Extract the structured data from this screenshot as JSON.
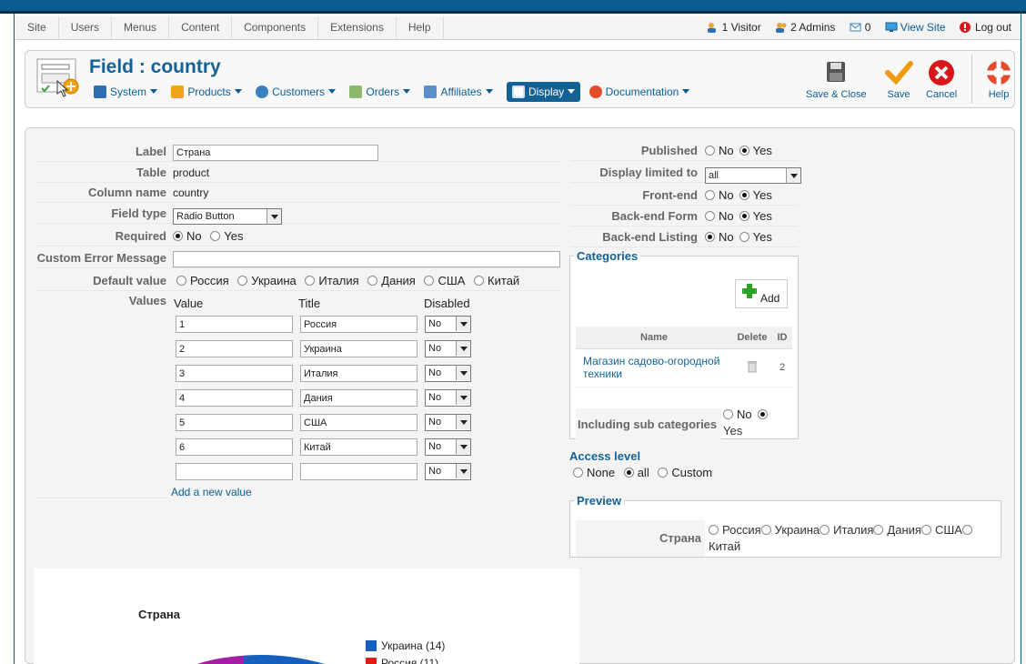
{
  "menubar": {
    "items": [
      "Site",
      "Users",
      "Menus",
      "Content",
      "Components",
      "Extensions",
      "Help"
    ],
    "visitors": "1 Visitor",
    "admins": "2 Admins",
    "messages": "0",
    "view_site": "View Site",
    "logout": "Log out"
  },
  "header": {
    "title": "Field : country",
    "submenu": [
      {
        "label": "System",
        "icon": "tools-icon"
      },
      {
        "label": "Products",
        "icon": "box-icon"
      },
      {
        "label": "Customers",
        "icon": "users-icon"
      },
      {
        "label": "Orders",
        "icon": "orders-icon"
      },
      {
        "label": "Affiliates",
        "icon": "affiliates-icon"
      },
      {
        "label": "Display",
        "icon": "display-icon",
        "active": true
      },
      {
        "label": "Documentation",
        "icon": "lifebuoy-icon"
      }
    ],
    "buttons": {
      "save_close": "Save & Close",
      "save": "Save",
      "cancel": "Cancel",
      "help": "Help"
    }
  },
  "form": {
    "label_lbl": "Label",
    "label_val": "Страна",
    "table_lbl": "Table",
    "table_val": "product",
    "column_lbl": "Column name",
    "column_val": "country",
    "fieldtype_lbl": "Field type",
    "fieldtype_val": "Radio Button",
    "required_lbl": "Required",
    "required_no": "No",
    "required_yes": "Yes",
    "error_lbl": "Custom Error Message",
    "error_val": "",
    "default_lbl": "Default value",
    "default_options": [
      "Россия",
      "Украина",
      "Италия",
      "Дания",
      "США",
      "Китай"
    ],
    "values_lbl": "Values",
    "col_value": "Value",
    "col_title": "Title",
    "col_disabled": "Disabled",
    "values": [
      {
        "value": "1",
        "title": "Россия",
        "disabled": "No"
      },
      {
        "value": "2",
        "title": "Украина",
        "disabled": "No"
      },
      {
        "value": "3",
        "title": "Италия",
        "disabled": "No"
      },
      {
        "value": "4",
        "title": "Дания",
        "disabled": "No"
      },
      {
        "value": "5",
        "title": "США",
        "disabled": "No"
      },
      {
        "value": "6",
        "title": "Китай",
        "disabled": "No"
      },
      {
        "value": "",
        "title": "",
        "disabled": "No"
      }
    ],
    "add_value": "Add a new value"
  },
  "right": {
    "published_lbl": "Published",
    "display_limited_lbl": "Display limited to",
    "display_limited_val": "all",
    "frontend_lbl": "Front-end",
    "backend_form_lbl": "Back-end Form",
    "backend_listing_lbl": "Back-end Listing",
    "no": "No",
    "yes": "Yes",
    "categories_legend": "Categories",
    "add": "Add",
    "cat_headers": [
      "Name",
      "Delete",
      "ID"
    ],
    "cat_name": "Магазин садово-огородной техники",
    "cat_id": "2",
    "sub_lbl": "Including sub categories",
    "access_lbl": "Access level",
    "access_none": "None",
    "access_all": "all",
    "access_custom": "Custom",
    "preview_legend": "Preview",
    "preview_lbl": "Страна",
    "preview_opts": [
      "Россия",
      "Украина",
      "Италия",
      "Дания",
      "США",
      "Китай"
    ]
  },
  "chart": {
    "title": "Страна",
    "legend": [
      {
        "label": "Украина (14)",
        "color": "#1560bd"
      },
      {
        "label": "Россия (11)",
        "color": "#e31b1b"
      }
    ]
  }
}
